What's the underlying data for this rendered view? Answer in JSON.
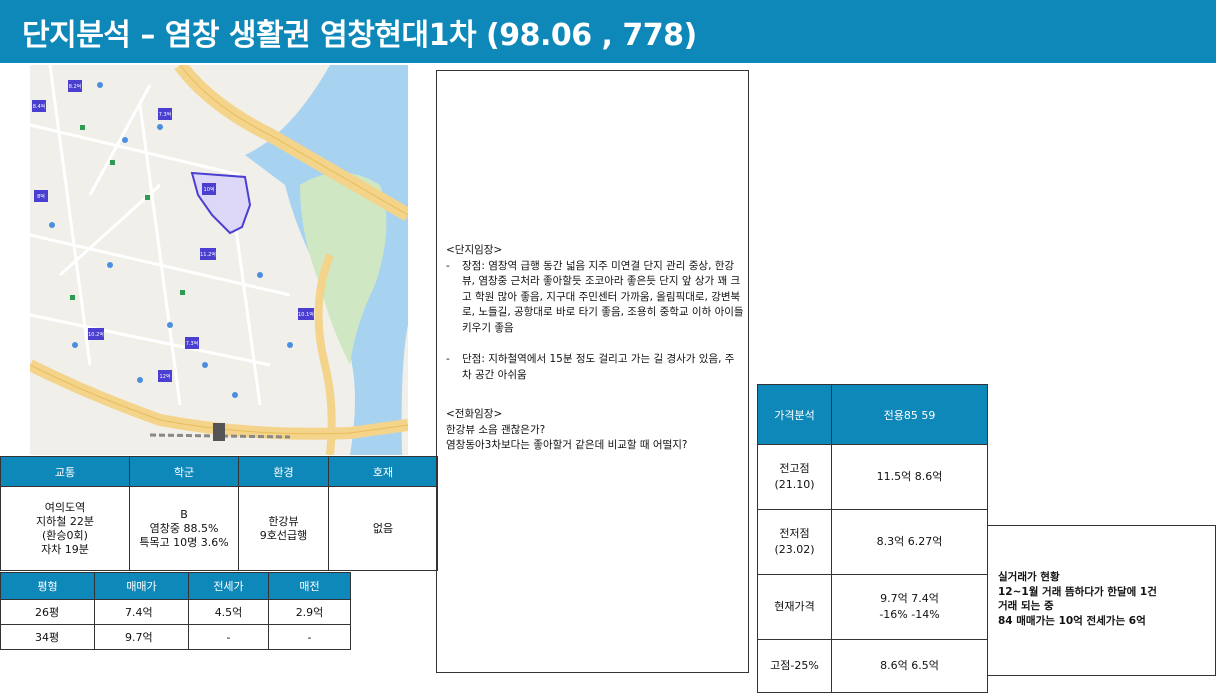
{
  "header": {
    "title": "단지분석 – 염창 생활권 염창현대1차 (98.06 , 778)"
  },
  "map": {
    "labels": [
      "8.4억",
      "8.2억",
      "7.3억",
      "8억",
      "11.2억",
      "10.1억",
      "7.3억",
      "10.2억",
      "10억",
      "12억"
    ]
  },
  "location_table": {
    "headers": [
      "교통",
      "학군",
      "환경",
      "호재"
    ],
    "transport": [
      "여의도역",
      "지하철 22분",
      "(환승0회)",
      "자차 19분"
    ],
    "school": [
      "B",
      "염창중 88.5%",
      "특목고 10명 3.6%"
    ],
    "environment": [
      "한강뷰",
      "9호선급행"
    ],
    "development": "없음"
  },
  "price_table": {
    "headers": [
      "평형",
      "매매가",
      "전세가",
      "매전"
    ],
    "rows": [
      [
        "26평",
        "7.4억",
        "4.5억",
        "2.9억"
      ],
      [
        "34평",
        "9.7억",
        "-",
        "-"
      ]
    ]
  },
  "notes": {
    "site_title": "<단지임장>",
    "pros": "장점: 염창역 급행 동간 넓음 지주 미연결 단지 관리 중상, 한강뷰, 염창중 근처라 좋아할듯 조코아라 좋은듯 단지 앞 상가 꽤 크고 학원 많아 좋음, 지구대 주민센터 가까움, 올림픽대로, 강변북로, 노들길, 공항대로 바로 타기 좋음, 조용히 중학교 이하 아이들 키우기 좋음",
    "cons": "단점: 지하철역에서 15분 정도 걸리고 가는 길 경사가 있음, 주차 공간 아쉬움",
    "phone_title": "<전화임장>",
    "phone_q1": "한강뷰 소음 괜찮은가?",
    "phone_q2": "염창동아3차보다는 좋아할거 같은데 비교할 때 어떨지?"
  },
  "analysis_table": {
    "header_label": "가격분석",
    "header_value": "전용85 59",
    "rows": [
      {
        "label": [
          "전고점",
          "(21.10)"
        ],
        "value": [
          "11.5억 8.6억"
        ]
      },
      {
        "label": [
          "전저점",
          "(23.02)"
        ],
        "value": [
          "8.3억 6.27억"
        ]
      },
      {
        "label": [
          "현재가격"
        ],
        "value": [
          "9.7억 7.4억",
          "-16% -14%"
        ]
      },
      {
        "label": [
          "고점-25%"
        ],
        "value": [
          "8.6억 6.5억"
        ]
      }
    ]
  },
  "summary": {
    "lines": [
      "실거래가 현황",
      "12~1월 거래 뜸하다가 한달에 1건",
      "거래 되는 중",
      "84 매매가는 10억 전세가는 6억"
    ]
  },
  "colors": {
    "header": "#0e87b9",
    "river": "#a7d3f0",
    "park": "#cfe7c3",
    "road": "#f3d48a",
    "marker": "#4a3fd1"
  }
}
